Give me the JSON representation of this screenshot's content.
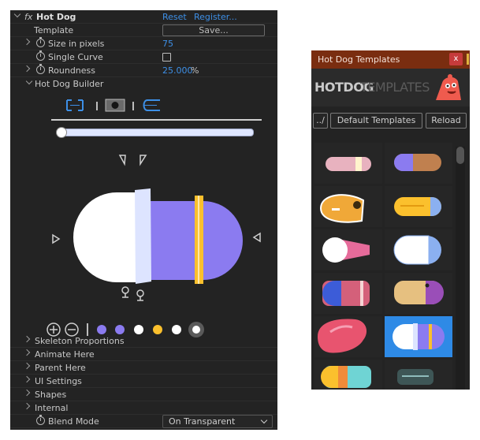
{
  "fx_panel": {
    "fx_label": "fx",
    "effect_name": "Hot Dog",
    "reset": "Reset",
    "register": "Register...",
    "template_label": "Template",
    "save_button": "Save...",
    "size_label": "Size in pixels",
    "size_value": "75",
    "curve_label": "Single Curve",
    "curve_checked": false,
    "roundness_label": "Roundness",
    "roundness_value": "25.000",
    "roundness_unit": "%",
    "builder_label": "Hot Dog Builder",
    "slider_value": 0.0,
    "sections": [
      "Skeleton Proportions",
      "Animate Here",
      "Parent Here",
      "UI Settings",
      "Shapes",
      "Internal"
    ],
    "blend_label": "Blend Mode",
    "blend_value": "On Transparent",
    "swatch_colors": [
      "#8b7bf0",
      "#8b7bf0",
      "#ffffff",
      "#fbc02d",
      "#ffffff",
      "#ffffff"
    ]
  },
  "templates_panel": {
    "title": "Hot Dog Templates",
    "close": "x",
    "logo_bold": "HOTDOG",
    "logo_light": "TEMPLATES",
    "back_button": "../",
    "default_button": "Default Templates",
    "reload_button": "Reload"
  },
  "colors": {
    "panel_bg": "#232323",
    "accent_blue": "#3d8fe6",
    "title_bar": "#7a2d10",
    "bun_purple": "#8b7bf0",
    "gold": "#fbc02d"
  }
}
